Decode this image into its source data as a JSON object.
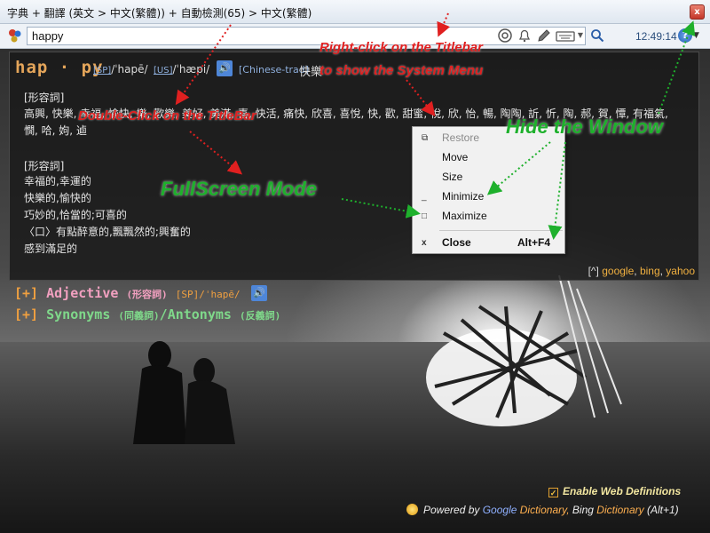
{
  "window": {
    "title": "字典 + 翻譯 (英文 > 中文(繁體)) + 自動檢測(65) > 中文(繁體)",
    "close_glyph": "x"
  },
  "toolbar": {
    "search_value": "happy",
    "clock": "12:49:14",
    "icons": [
      "logo-icon",
      "lifebuoy-icon",
      "bell-icon",
      "pencil-icon",
      "keyboard-icon",
      "dropdown-caret-icon",
      "magnifier-icon",
      "help-icon"
    ]
  },
  "entry": {
    "headword": "hap · py",
    "pron_sp_tag": "[SP]",
    "pron_sp": "/ˈhapē/",
    "pron_us_tag": "[US]",
    "pron_us": "/ˈhæpi/",
    "lang_tag": "[Chinese-trad]",
    "translation": "快樂",
    "sections": [
      {
        "label": "[形容詞]",
        "lines": [
          "高興, 快樂, 幸福, 愉快, 樂, 歡樂, 美好, 美滿, 喜, 快活, 痛快, 欣喜, 喜悅, 快, 歡, 甜蜜, 悅, 欣, 怡, 暢, 陶陶, 訢, 忻, 陶, 郝, 賀, 憛, 有福氣,",
          "憪, 哈, 姁, 逌"
        ]
      },
      {
        "label": "[形容詞]",
        "lines": [
          "幸福的,幸運的",
          "快樂的,愉快的",
          "巧妙的,恰當的;可喜的",
          "〈口〉有點醉意的,飄飄然的;興奮的",
          "感到滿足的"
        ]
      }
    ],
    "source_prefix": "[^]",
    "sources": [
      "google",
      "bing",
      "yahoo"
    ]
  },
  "system_menu": {
    "items": [
      {
        "label": "Restore",
        "glyph": "⧉",
        "disabled": true
      },
      {
        "label": "Move",
        "glyph": "",
        "disabled": false
      },
      {
        "label": "Size",
        "glyph": "",
        "disabled": false
      },
      {
        "label": "Minimize",
        "glyph": "_",
        "disabled": false
      },
      {
        "label": "Maximize",
        "glyph": "□",
        "disabled": false
      },
      {
        "label": "Close",
        "glyph": "x",
        "disabled": false,
        "shortcut": "Alt+F4"
      }
    ]
  },
  "lower_sections": {
    "adjective": {
      "bracket": "[+]",
      "label": "Adjective",
      "cn": "(形容詞)",
      "tag": "[SP]",
      "pron": "/ˈhapē/"
    },
    "synonyms": {
      "bracket": "[+]",
      "label": "Synonyms",
      "cn1": "(同義詞)",
      "sep": "/",
      "label2": "Antonyms",
      "cn2": "(反義詞)"
    }
  },
  "footer": {
    "enable_web_definitions": "Enable Web Definitions",
    "checked_glyph": "✓",
    "powered_prefix": "Powered by",
    "google": "Google",
    "google_dictionary": "Dictionary,",
    "bing": "Bing",
    "bing_dictionary": "Dictionary",
    "shortcut": "(Alt+1)"
  },
  "annotations": {
    "right_click_line1": "Right-click on the Titlebar",
    "right_click_line2": "to show the System Menu",
    "double_click": "Double-Click on the TitleBar",
    "fullscreen": "FullScreen Mode",
    "hide": "Hide the Window"
  },
  "colors": {
    "annotation_red": "#e02020",
    "annotation_green": "#1eb02c",
    "headword": "#e4a55a",
    "link_orange": "#f0b040"
  }
}
